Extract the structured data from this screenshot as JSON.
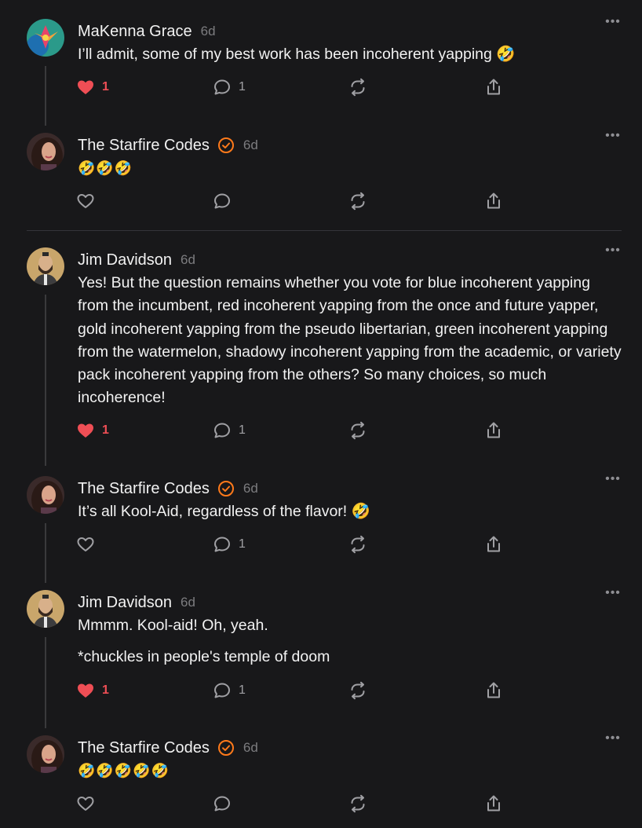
{
  "colors": {
    "accent": "#ff7a1a",
    "like": "#ef4e55",
    "background": "#18181a"
  },
  "posts": [
    {
      "author": "MaKenna Grace",
      "verified": false,
      "time": "6d",
      "paragraphs": [
        "I’ll admit, some of my best work has been incoherent yapping 🤣"
      ],
      "likes": "1",
      "liked": true,
      "comments": "1"
    },
    {
      "author": "The Starfire Codes",
      "verified": true,
      "time": "6d",
      "paragraphs": [
        "🤣🤣🤣"
      ],
      "likes": "",
      "liked": false,
      "comments": ""
    },
    {
      "author": "Jim Davidson",
      "verified": false,
      "time": "6d",
      "paragraphs": [
        "Yes! But the question remains whether you vote for blue incoherent yapping from the incumbent, red incoherent yapping from the once and future yapper, gold incoherent yapping from the pseudo libertarian, green incoherent yapping from the watermelon, shadowy incoherent yapping from the academic, or variety pack incoherent yapping from the others? So many choices, so much incoherence!"
      ],
      "likes": "1",
      "liked": true,
      "comments": "1"
    },
    {
      "author": "The Starfire Codes",
      "verified": true,
      "time": "6d",
      "paragraphs": [
        "It’s all Kool-Aid, regardless of the flavor! 🤣"
      ],
      "likes": "",
      "liked": false,
      "comments": "1"
    },
    {
      "author": "Jim Davidson",
      "verified": false,
      "time": "6d",
      "paragraphs": [
        "Mmmm. Kool-aid! Oh, yeah.",
        "*chuckles in people's temple of doom"
      ],
      "likes": "1",
      "liked": true,
      "comments": "1"
    },
    {
      "author": "The Starfire Codes",
      "verified": true,
      "time": "6d",
      "paragraphs": [
        "🤣🤣🤣🤣🤣"
      ],
      "likes": "",
      "liked": false,
      "comments": ""
    }
  ],
  "icons": {
    "like": "heart-icon",
    "comment": "comment-bubble-icon",
    "restack": "restack-icon",
    "share": "share-icon",
    "more": "more-dots-icon",
    "verified": "verified-check-icon"
  }
}
